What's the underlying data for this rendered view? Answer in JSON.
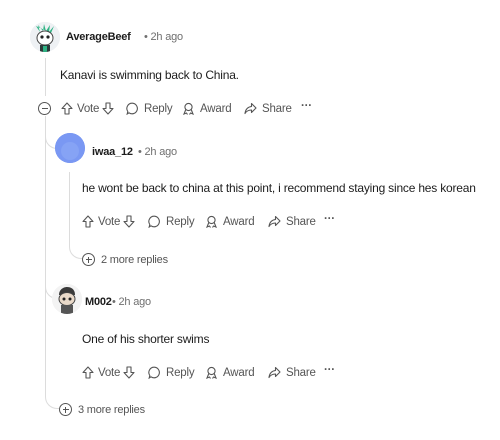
{
  "comments": [
    {
      "username": "AverageBeef",
      "time": "• 2h ago",
      "text": "Kanavi is swimming back to China.",
      "actions": {
        "vote": "Vote",
        "reply": "Reply",
        "award": "Award",
        "share": "Share",
        "more": "···"
      }
    },
    {
      "username": "iwaa_12",
      "time": "• 2h ago",
      "text": "he wont be back to china at this point, i recommend staying since hes korean",
      "actions": {
        "vote": "Vote",
        "reply": "Reply",
        "award": "Award",
        "share": "Share",
        "more": "···"
      },
      "more_replies": "2 more replies"
    },
    {
      "username": "M002",
      "time": "• 2h ago",
      "text": "One of his shorter swims",
      "actions": {
        "vote": "Vote",
        "reply": "Reply",
        "award": "Award",
        "share": "Share",
        "more": "···"
      }
    }
  ],
  "thread_more_replies": "3 more replies",
  "colors": {
    "text": "#1c1c1c",
    "muted": "#6f6f6f",
    "line": "#dcdcdc",
    "avatar_blue": "#6b8ef0"
  }
}
